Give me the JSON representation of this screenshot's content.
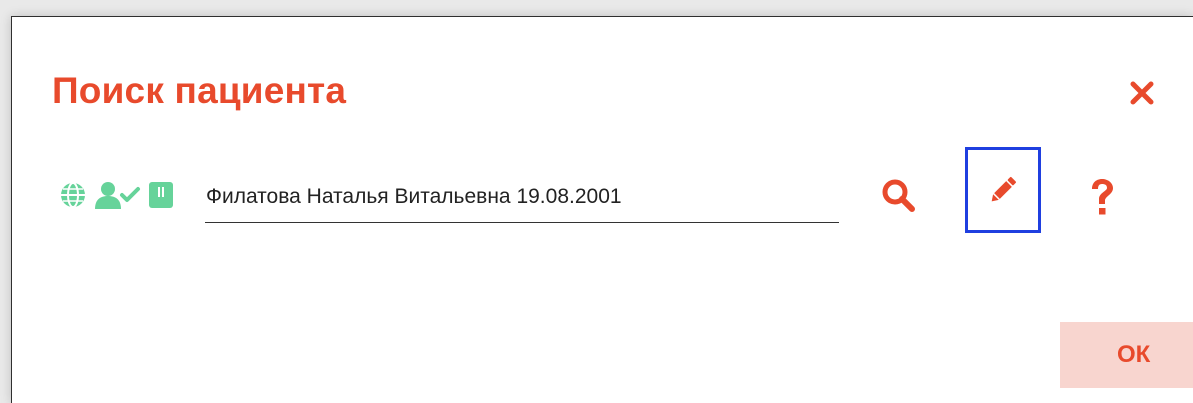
{
  "dialog": {
    "title": "Поиск пациента",
    "close_icon": "close-icon"
  },
  "search": {
    "value": "Филатова Наталья Витальевна 19.08.2001",
    "source_icons": [
      "globe-icon",
      "user-check-icon",
      "card-icon"
    ]
  },
  "actions": {
    "search_icon": "search-icon",
    "edit_icon": "pencil-icon",
    "help_icon": "question-icon"
  },
  "footer": {
    "ok_label": "ОК"
  },
  "colors": {
    "accent": "#e84a2c",
    "icon_green": "#66d39a",
    "focus_border": "#1f3fe0",
    "ok_bg": "#f8d5cf"
  }
}
